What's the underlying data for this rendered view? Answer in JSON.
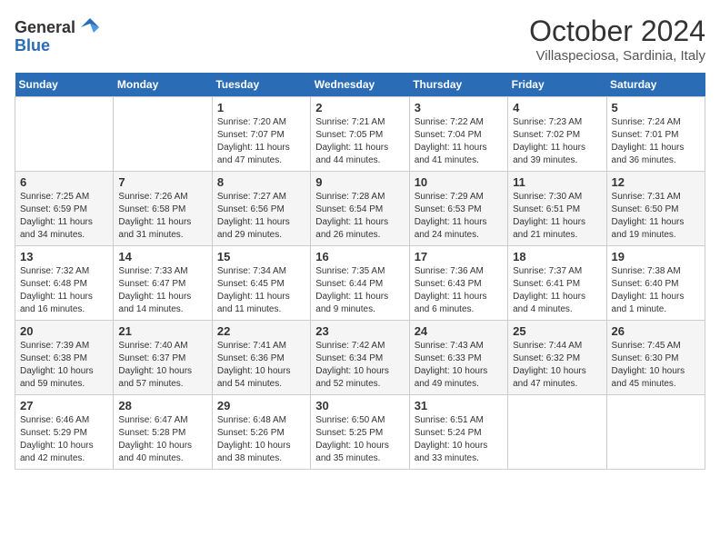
{
  "header": {
    "logo_general": "General",
    "logo_blue": "Blue",
    "month_year": "October 2024",
    "location": "Villaspeciosa, Sardinia, Italy"
  },
  "days_of_week": [
    "Sunday",
    "Monday",
    "Tuesday",
    "Wednesday",
    "Thursday",
    "Friday",
    "Saturday"
  ],
  "weeks": [
    [
      {
        "day": "",
        "sunrise": "",
        "sunset": "",
        "daylight": ""
      },
      {
        "day": "",
        "sunrise": "",
        "sunset": "",
        "daylight": ""
      },
      {
        "day": "1",
        "sunrise": "Sunrise: 7:20 AM",
        "sunset": "Sunset: 7:07 PM",
        "daylight": "Daylight: 11 hours and 47 minutes."
      },
      {
        "day": "2",
        "sunrise": "Sunrise: 7:21 AM",
        "sunset": "Sunset: 7:05 PM",
        "daylight": "Daylight: 11 hours and 44 minutes."
      },
      {
        "day": "3",
        "sunrise": "Sunrise: 7:22 AM",
        "sunset": "Sunset: 7:04 PM",
        "daylight": "Daylight: 11 hours and 41 minutes."
      },
      {
        "day": "4",
        "sunrise": "Sunrise: 7:23 AM",
        "sunset": "Sunset: 7:02 PM",
        "daylight": "Daylight: 11 hours and 39 minutes."
      },
      {
        "day": "5",
        "sunrise": "Sunrise: 7:24 AM",
        "sunset": "Sunset: 7:01 PM",
        "daylight": "Daylight: 11 hours and 36 minutes."
      }
    ],
    [
      {
        "day": "6",
        "sunrise": "Sunrise: 7:25 AM",
        "sunset": "Sunset: 6:59 PM",
        "daylight": "Daylight: 11 hours and 34 minutes."
      },
      {
        "day": "7",
        "sunrise": "Sunrise: 7:26 AM",
        "sunset": "Sunset: 6:58 PM",
        "daylight": "Daylight: 11 hours and 31 minutes."
      },
      {
        "day": "8",
        "sunrise": "Sunrise: 7:27 AM",
        "sunset": "Sunset: 6:56 PM",
        "daylight": "Daylight: 11 hours and 29 minutes."
      },
      {
        "day": "9",
        "sunrise": "Sunrise: 7:28 AM",
        "sunset": "Sunset: 6:54 PM",
        "daylight": "Daylight: 11 hours and 26 minutes."
      },
      {
        "day": "10",
        "sunrise": "Sunrise: 7:29 AM",
        "sunset": "Sunset: 6:53 PM",
        "daylight": "Daylight: 11 hours and 24 minutes."
      },
      {
        "day": "11",
        "sunrise": "Sunrise: 7:30 AM",
        "sunset": "Sunset: 6:51 PM",
        "daylight": "Daylight: 11 hours and 21 minutes."
      },
      {
        "day": "12",
        "sunrise": "Sunrise: 7:31 AM",
        "sunset": "Sunset: 6:50 PM",
        "daylight": "Daylight: 11 hours and 19 minutes."
      }
    ],
    [
      {
        "day": "13",
        "sunrise": "Sunrise: 7:32 AM",
        "sunset": "Sunset: 6:48 PM",
        "daylight": "Daylight: 11 hours and 16 minutes."
      },
      {
        "day": "14",
        "sunrise": "Sunrise: 7:33 AM",
        "sunset": "Sunset: 6:47 PM",
        "daylight": "Daylight: 11 hours and 14 minutes."
      },
      {
        "day": "15",
        "sunrise": "Sunrise: 7:34 AM",
        "sunset": "Sunset: 6:45 PM",
        "daylight": "Daylight: 11 hours and 11 minutes."
      },
      {
        "day": "16",
        "sunrise": "Sunrise: 7:35 AM",
        "sunset": "Sunset: 6:44 PM",
        "daylight": "Daylight: 11 hours and 9 minutes."
      },
      {
        "day": "17",
        "sunrise": "Sunrise: 7:36 AM",
        "sunset": "Sunset: 6:43 PM",
        "daylight": "Daylight: 11 hours and 6 minutes."
      },
      {
        "day": "18",
        "sunrise": "Sunrise: 7:37 AM",
        "sunset": "Sunset: 6:41 PM",
        "daylight": "Daylight: 11 hours and 4 minutes."
      },
      {
        "day": "19",
        "sunrise": "Sunrise: 7:38 AM",
        "sunset": "Sunset: 6:40 PM",
        "daylight": "Daylight: 11 hours and 1 minute."
      }
    ],
    [
      {
        "day": "20",
        "sunrise": "Sunrise: 7:39 AM",
        "sunset": "Sunset: 6:38 PM",
        "daylight": "Daylight: 10 hours and 59 minutes."
      },
      {
        "day": "21",
        "sunrise": "Sunrise: 7:40 AM",
        "sunset": "Sunset: 6:37 PM",
        "daylight": "Daylight: 10 hours and 57 minutes."
      },
      {
        "day": "22",
        "sunrise": "Sunrise: 7:41 AM",
        "sunset": "Sunset: 6:36 PM",
        "daylight": "Daylight: 10 hours and 54 minutes."
      },
      {
        "day": "23",
        "sunrise": "Sunrise: 7:42 AM",
        "sunset": "Sunset: 6:34 PM",
        "daylight": "Daylight: 10 hours and 52 minutes."
      },
      {
        "day": "24",
        "sunrise": "Sunrise: 7:43 AM",
        "sunset": "Sunset: 6:33 PM",
        "daylight": "Daylight: 10 hours and 49 minutes."
      },
      {
        "day": "25",
        "sunrise": "Sunrise: 7:44 AM",
        "sunset": "Sunset: 6:32 PM",
        "daylight": "Daylight: 10 hours and 47 minutes."
      },
      {
        "day": "26",
        "sunrise": "Sunrise: 7:45 AM",
        "sunset": "Sunset: 6:30 PM",
        "daylight": "Daylight: 10 hours and 45 minutes."
      }
    ],
    [
      {
        "day": "27",
        "sunrise": "Sunrise: 6:46 AM",
        "sunset": "Sunset: 5:29 PM",
        "daylight": "Daylight: 10 hours and 42 minutes."
      },
      {
        "day": "28",
        "sunrise": "Sunrise: 6:47 AM",
        "sunset": "Sunset: 5:28 PM",
        "daylight": "Daylight: 10 hours and 40 minutes."
      },
      {
        "day": "29",
        "sunrise": "Sunrise: 6:48 AM",
        "sunset": "Sunset: 5:26 PM",
        "daylight": "Daylight: 10 hours and 38 minutes."
      },
      {
        "day": "30",
        "sunrise": "Sunrise: 6:50 AM",
        "sunset": "Sunset: 5:25 PM",
        "daylight": "Daylight: 10 hours and 35 minutes."
      },
      {
        "day": "31",
        "sunrise": "Sunrise: 6:51 AM",
        "sunset": "Sunset: 5:24 PM",
        "daylight": "Daylight: 10 hours and 33 minutes."
      },
      {
        "day": "",
        "sunrise": "",
        "sunset": "",
        "daylight": ""
      },
      {
        "day": "",
        "sunrise": "",
        "sunset": "",
        "daylight": ""
      }
    ]
  ]
}
